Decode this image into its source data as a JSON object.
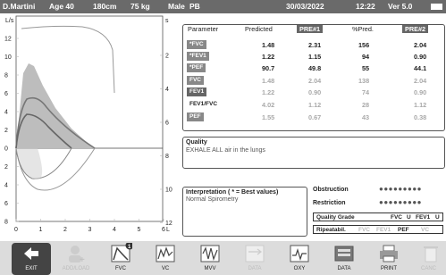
{
  "header": {
    "patient": "D.Martini",
    "age": "Age 40",
    "height": "180cm",
    "weight": "75 kg",
    "sex": "Male",
    "ethnic": "PB",
    "date": "30/03/2022",
    "time": "12:22",
    "version": "Ver 5.0"
  },
  "plot": {
    "y_unit": "L/s",
    "x_unit": "L",
    "right_unit": "s",
    "y_ticks": [
      "12",
      "10",
      "8",
      "6",
      "4",
      "2",
      "0",
      "2",
      "4",
      "6",
      "8"
    ],
    "x_ticks": [
      "0",
      "1",
      "2",
      "3",
      "4",
      "5",
      "6"
    ],
    "right_ticks": [
      "2",
      "4",
      "6",
      "8",
      "10",
      "12"
    ]
  },
  "table": {
    "columns": [
      "Parameter",
      "Predicted",
      "PRE#1",
      "%Pred.",
      "PRE#2"
    ],
    "rows": [
      {
        "name": "*FVC",
        "predicted": "1.48",
        "pre1": "2.31",
        "pct": "156",
        "pre2": "2.04"
      },
      {
        "name": "*FEV1",
        "predicted": "1.22",
        "pre1": "1.15",
        "pct": "94",
        "pre2": "0.90"
      },
      {
        "name": "*PEF",
        "predicted": "90.7",
        "pre1": "49.8",
        "pct": "55",
        "pre2": "44.1"
      },
      {
        "name": "FVC",
        "predicted": "1.48",
        "pre1": "2.04",
        "pct": "138",
        "pre2": "2.04"
      },
      {
        "name": "FEV1",
        "predicted": "1.22",
        "pre1": "0.90",
        "pct": "74",
        "pre2": "0.90"
      },
      {
        "name": "FEV1/FVC",
        "predicted": "4.02",
        "pct": "28",
        "pre1": "1.12",
        "pre2": "1.12"
      },
      {
        "name": "PEF",
        "predicted": "1.55",
        "pre1": "0.67",
        "pct": "43",
        "pre2": "0.38"
      }
    ]
  },
  "quality": {
    "title": "Quality",
    "text": "EXHALE ALL air in the lungs"
  },
  "interpretation": {
    "title": "Interpretation ( * = Best values)",
    "text": "Normal Spirometry"
  },
  "obstruction": {
    "label": "Obstruction",
    "dots": "●●●●●●●●●"
  },
  "restriction": {
    "label": "Restriction",
    "dots": "●●●●●●●●●"
  },
  "quality_grade": {
    "label": "Quality Grade",
    "fvc_label": "FVC",
    "fvc": "U",
    "fev1_label": "FEV1",
    "fev1": "U"
  },
  "repeatability": {
    "label": "Ripeatabil.",
    "fvc": "FVC",
    "fev1": "FEV1",
    "pef": "PEF",
    "vc": "VC"
  },
  "toolbar": {
    "badge": "1",
    "buttons": [
      "EXIT",
      "ADD/LOAD",
      "FVC",
      "VC",
      "MVV",
      "DATA",
      "OXY",
      "DATA",
      "PRINT",
      "CANC"
    ]
  }
}
